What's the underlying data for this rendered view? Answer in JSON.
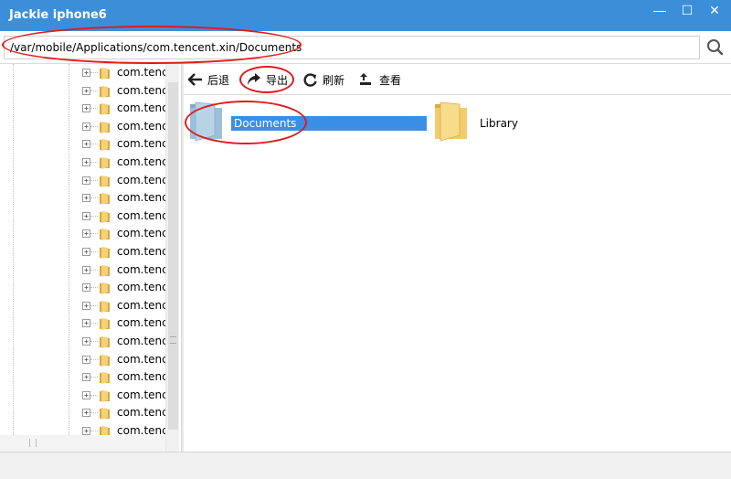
{
  "window": {
    "title": "Jackie iphone6",
    "min_glyph": "—",
    "max_glyph": "☐",
    "close_glyph": "✕"
  },
  "pathbar": {
    "path": "/var/mobile/Applications/com.tencent.xin/Documents",
    "search_icon": "search-icon"
  },
  "tree": {
    "items": [
      {
        "label": "com.tenc"
      },
      {
        "label": "com.tenc"
      },
      {
        "label": "com.tenc"
      },
      {
        "label": "com.tenc"
      },
      {
        "label": "com.tenc"
      },
      {
        "label": "com.tenc"
      },
      {
        "label": "com.tenc"
      },
      {
        "label": "com.tenc"
      },
      {
        "label": "com.tenc"
      },
      {
        "label": "com.tenc"
      },
      {
        "label": "com.tenc"
      },
      {
        "label": "com.tenc"
      },
      {
        "label": "com.tenc"
      },
      {
        "label": "com.tenc"
      },
      {
        "label": "com.tenc"
      },
      {
        "label": "com.tenc"
      },
      {
        "label": "com.tenc"
      },
      {
        "label": "com.tenc"
      },
      {
        "label": "com.tenc"
      },
      {
        "label": "com.tenc"
      },
      {
        "label": "com.tenc"
      },
      {
        "label": "com.tenc"
      }
    ]
  },
  "toolbar": {
    "back_label": "后退",
    "export_label": "导出",
    "refresh_label": "刷新",
    "view_label": "查看"
  },
  "content": {
    "items": [
      {
        "name": "Documents",
        "selected": true
      },
      {
        "name": "Library",
        "selected": false
      }
    ]
  },
  "colors": {
    "titlebar": "#3b8fd8",
    "selection": "#3a8ee6",
    "annotation": "#e01b1b",
    "folder_yellow": "#f2c94c",
    "folder_blue": "#8fb6d6"
  }
}
